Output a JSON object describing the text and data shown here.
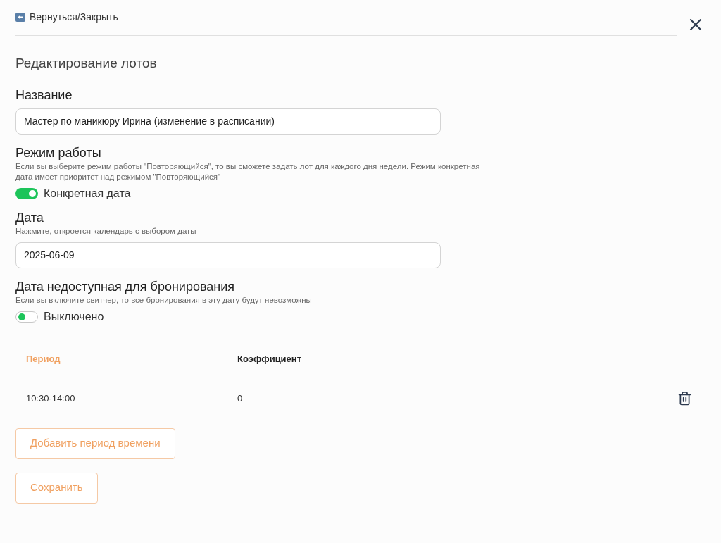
{
  "back_link": "Вернуться/Закрыть",
  "title": "Редактирование лотов",
  "name_field": {
    "label": "Название",
    "value": "Мастер по маникюру Ирина (изменение в расписании)"
  },
  "mode": {
    "label": "Режим работы",
    "hint": "Если вы выберите режим работы \"Повторяющийся\", то вы сможете задать лот для каждого дня недели. Режим конкретная дата имеет приоритет над режимом \"Повторяющийся\"",
    "toggle": {
      "label": "Конкретная дата",
      "on": true
    }
  },
  "date_field": {
    "label": "Дата",
    "hint": "Нажмите, откроется календарь с выбором даты",
    "value": "2025-06-09"
  },
  "unavailable": {
    "label": "Дата недоступная для бронирования",
    "hint": "Если вы включите свитчер, то все бронирования в эту дату будут невозможны",
    "toggle": {
      "label": "Выключено",
      "on": false
    }
  },
  "table": {
    "columns": [
      {
        "label": "Период",
        "selected": true
      },
      {
        "label": "Коэффициент",
        "selected": false
      }
    ],
    "rows": [
      {
        "cells": [
          "10:30-14:00",
          "0"
        ]
      }
    ]
  },
  "buttons": [
    "Добавить период времени",
    "Сохранить"
  ]
}
